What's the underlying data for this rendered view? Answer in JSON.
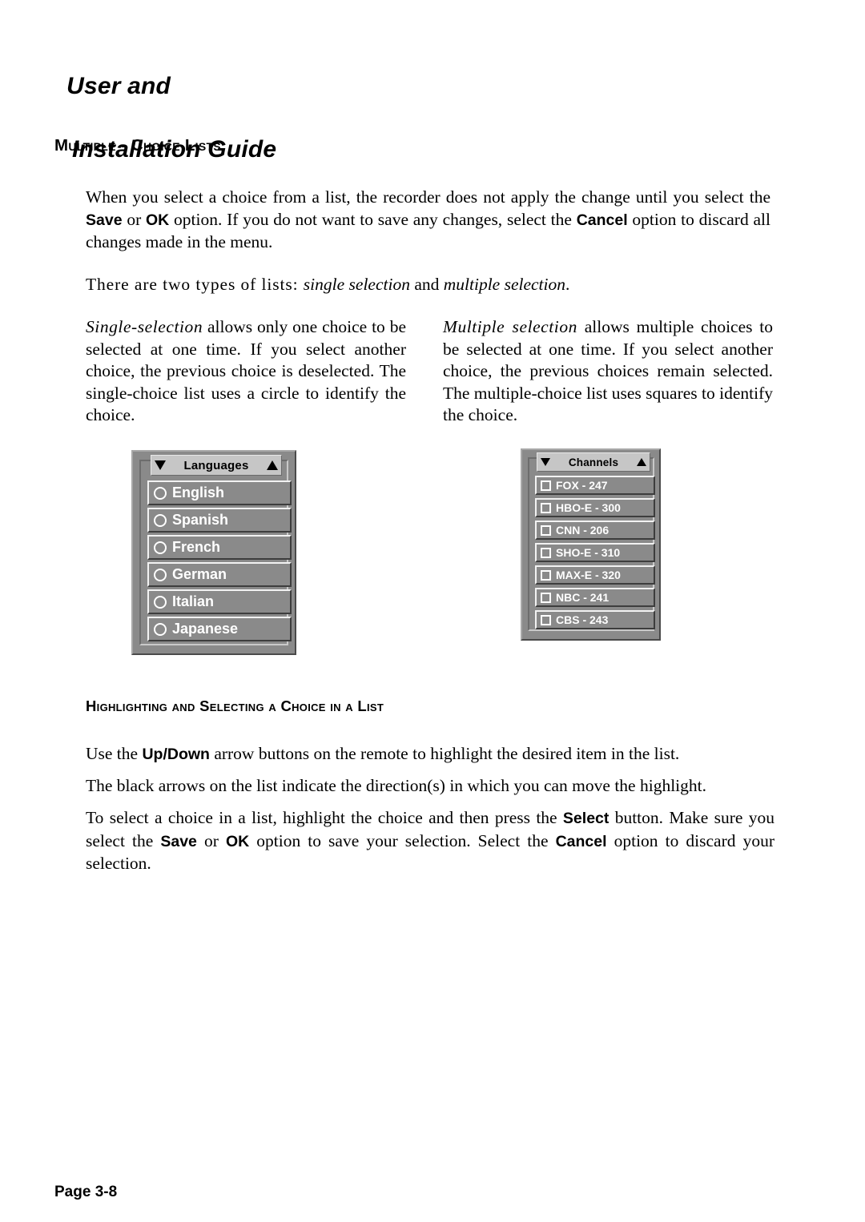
{
  "header": {
    "title_line_1": "User and",
    "title_line_2": "Installation Guide"
  },
  "sections": {
    "multiple_choice_heading": "Multiple - Choice Lists",
    "highlighting_heading": "Highlighting and Selecting a Choice in a List"
  },
  "paragraphs": {
    "intro_a": "When you select a choice from a list, the recorder does not apply the change until you select the ",
    "intro_save": "Save",
    "intro_b": " or ",
    "intro_ok": "OK",
    "intro_c": " option.  If you do not want to save any changes, select the ",
    "intro_cancel": "Cancel",
    "intro_d": " option to discard all changes made in the menu.",
    "types_a": "There are two types of lists: ",
    "types_single": "single selection",
    "types_b": " and ",
    "types_multiple": "multiple selection",
    "types_c": ".",
    "left_col_lead": "Single-selection",
    "left_col_body": " allows only one choice to be selected at one time.  If you select another choice, the previous choice is deselected.  The single-choice list uses a circle to identify the choice.",
    "right_col_lead": "Multiple selection",
    "right_col_body": " allows multiple choices to be selected at one time.  If you select another choice, the previous choices remain selected.  The multiple-choice list uses squares to identify the choice.",
    "use_a": "Use the ",
    "use_updown": "Up/Down",
    "use_b": " arrow buttons on the remote to highlight the desired item in the list.",
    "arrows": "The black arrows on the list indicate the direction(s) in which you can move the highlight.",
    "select_a": "To select a choice in a list, highlight the choice and then press the ",
    "select_select": "Select",
    "select_b": " button.  Make sure you select the ",
    "select_save": "Save",
    "select_c": " or ",
    "select_ok": "OK",
    "select_d": " option to save your selection.  Select the ",
    "select_cancel": "Cancel",
    "select_e": " option to discard your selection."
  },
  "widgets": {
    "languages": {
      "title": "Languages",
      "scroll_down_icon": "triangle-down-icon",
      "scroll_up_icon": "triangle-up-icon",
      "marker_type": "circle",
      "items": [
        {
          "label": "English"
        },
        {
          "label": "Spanish"
        },
        {
          "label": "French"
        },
        {
          "label": "German"
        },
        {
          "label": "Italian"
        },
        {
          "label": "Japanese"
        }
      ]
    },
    "channels": {
      "title": "Channels",
      "scroll_down_icon": "triangle-down-icon",
      "scroll_up_icon": "triangle-up-icon",
      "marker_type": "square",
      "items": [
        {
          "label": "FOX - 247"
        },
        {
          "label": "HBO-E - 300"
        },
        {
          "label": "CNN - 206"
        },
        {
          "label": "SHO-E - 310"
        },
        {
          "label": "MAX-E - 320"
        },
        {
          "label": "NBC - 241"
        },
        {
          "label": "CBS - 243"
        }
      ]
    }
  },
  "footer": {
    "page_label": "Page 3-8"
  },
  "colors": {
    "page_background": "#ffffff",
    "text": "#000000",
    "widget_frame": "#8a8a8a",
    "widget_titlebar": "#c6c6c6",
    "widget_row": "#8a8a8a",
    "widget_row_text": "#ffffff"
  }
}
